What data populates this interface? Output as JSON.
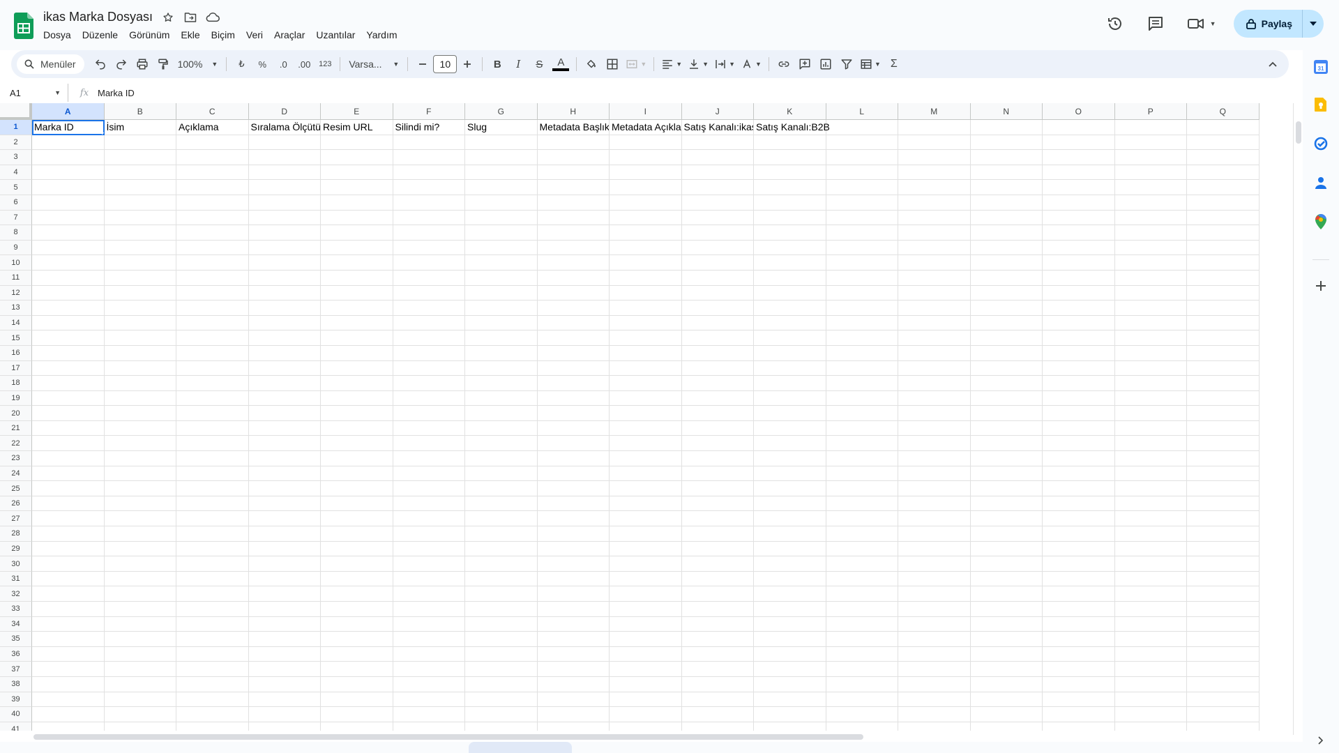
{
  "app": {
    "title": "ikas Marka Dosyası"
  },
  "menu": [
    "Dosya",
    "Düzenle",
    "Görünüm",
    "Ekle",
    "Biçim",
    "Veri",
    "Araçlar",
    "Uzantılar",
    "Yardım"
  ],
  "header": {
    "share_label": "Paylaş"
  },
  "toolbar": {
    "search_label": "Menüler",
    "zoom": "100%",
    "currency": "₺",
    "percent": "%",
    "decrease_decimal": ".0",
    "increase_decimal": ".00",
    "number_format": "123",
    "font": "Varsa...",
    "font_size": "10",
    "bold": "B",
    "italic": "I",
    "strike": "S",
    "text_color_letter": "A",
    "sum": "Σ"
  },
  "formula_bar": {
    "cell_ref": "A1",
    "fx": "fx",
    "value": "Marka ID"
  },
  "grid": {
    "columns": [
      "A",
      "B",
      "C",
      "D",
      "E",
      "F",
      "G",
      "H",
      "I",
      "J",
      "K",
      "L",
      "M",
      "N",
      "O",
      "P",
      "Q"
    ],
    "row_count": 41,
    "header_row": [
      "Marka ID",
      "İsim",
      "Açıklama",
      "Sıralama Ölçütü",
      "Resim URL",
      "Silindi mi?",
      "Slug",
      "Metadata Başlık",
      "Metadata Açıklama",
      "Satış Kanalı:ikas",
      "Satış Kanalı:B2B",
      "",
      "",
      "",
      "",
      "",
      ""
    ],
    "active_cell": "A1"
  },
  "colors": {
    "accent": "#1a73e8",
    "share_bg": "#c2e7ff",
    "toolbar_bg": "#edf2fa",
    "sheets_green": "#0f9d58"
  },
  "side_panel": {
    "icons": [
      "calendar-icon",
      "keep-icon",
      "tasks-icon",
      "contacts-icon",
      "maps-icon",
      "add-icon"
    ]
  }
}
